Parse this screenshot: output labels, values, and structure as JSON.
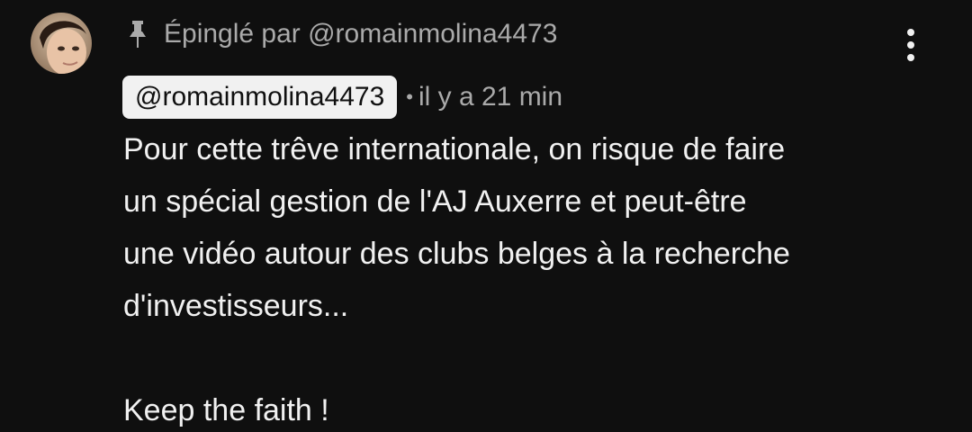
{
  "comment": {
    "pinned_label": "Épinglé par @romainmolina4473",
    "author_handle": "@romainmolina4473",
    "separator": "•",
    "timestamp": "il y a 21 min",
    "body": "Pour cette trêve internationale, on risque de faire\nun spécial gestion de l'AJ Auxerre et peut-être\nune vidéo autour des clubs belges à la recherche\nd'investisseurs...\n\nKeep the faith !"
  },
  "icons": {
    "pin": "pin-icon",
    "menu": "more-vertical-icon",
    "avatar": "user-avatar"
  },
  "colors": {
    "background": "#0f0f0f",
    "text_primary": "#f1f1f1",
    "text_secondary": "#aaaaaa",
    "chip_background": "#f1f1f1"
  }
}
